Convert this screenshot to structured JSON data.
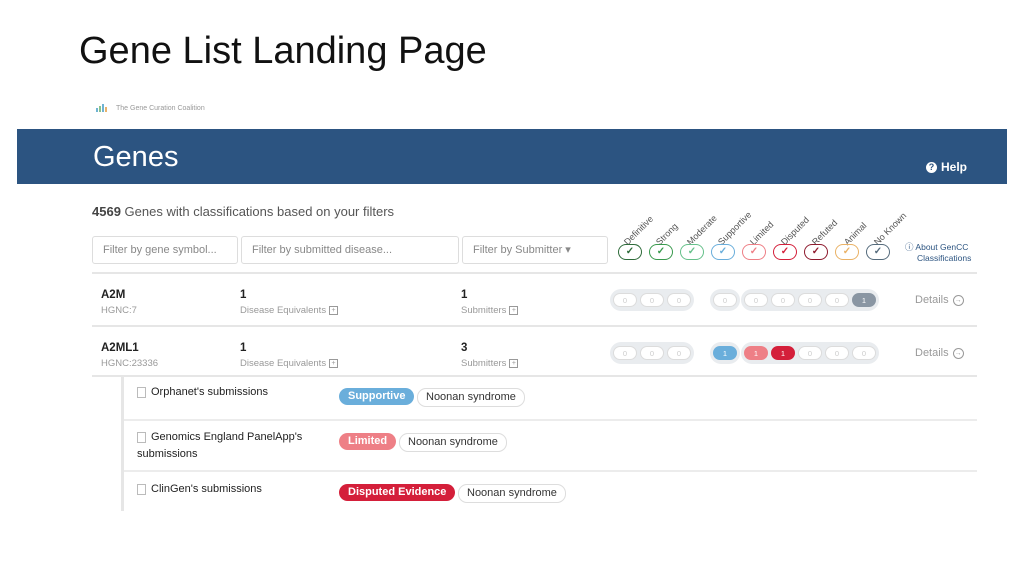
{
  "slide_title": "Gene List Landing Page",
  "logo_text": "The Gene Curation Coalition",
  "header": {
    "title": "Genes",
    "help_label": "Help",
    "help_icon": "question-circle-icon"
  },
  "summary": {
    "count": "4569",
    "text": "Genes with classifications based on your filters"
  },
  "filters": {
    "gene_placeholder": "Filter by gene symbol...",
    "disease_placeholder": "Filter by submitted disease...",
    "submitter_placeholder": "Filter by Submitter ▾"
  },
  "legend": [
    {
      "label": "Definitive",
      "color": "#2e6b3a"
    },
    {
      "label": "Strong",
      "color": "#3a9a4e"
    },
    {
      "label": "Moderate",
      "color": "#66c08a"
    },
    {
      "label": "Supportive",
      "color": "#6aaedb"
    },
    {
      "label": "Limited",
      "color": "#ee7f86"
    },
    {
      "label": "Disputed",
      "color": "#d41f3a"
    },
    {
      "label": "Refuted",
      "color": "#8e1b2e"
    },
    {
      "label": "Animal",
      "color": "#eab266"
    },
    {
      "label": "No Known",
      "color": "#556b7c"
    }
  ],
  "about": {
    "line1": "About GenCC",
    "line2": "Classifications"
  },
  "genes": [
    {
      "symbol": "A2M",
      "hgnc": "HGNC:7",
      "diseases_count": "1",
      "diseases_label": "Disease Equivalents",
      "submitters_count": "1",
      "submitters_label": "Submitters",
      "pills": [
        "0",
        "0",
        "0",
        "0",
        "0",
        "0",
        "0",
        "0",
        "1"
      ],
      "details": "Details"
    },
    {
      "symbol": "A2ML1",
      "hgnc": "HGNC:23336",
      "diseases_count": "1",
      "diseases_label": "Disease Equivalents",
      "submitters_count": "3",
      "submitters_label": "Submitters",
      "pills": [
        "0",
        "0",
        "0",
        "1",
        "1",
        "1",
        "0",
        "0",
        "0"
      ],
      "details": "Details"
    }
  ],
  "submissions": [
    {
      "submitter": "Orphanet's submissions",
      "classification": "Supportive",
      "color": "#6aaedb",
      "disease": "Noonan syndrome"
    },
    {
      "submitter_line1": "Genomics England PanelApp's",
      "submitter_line2": "submissions",
      "classification": "Limited",
      "color": "#ee7f86",
      "disease": "Noonan syndrome"
    },
    {
      "submitter": "ClinGen's submissions",
      "classification": "Disputed Evidence",
      "color": "#d41f3a",
      "disease": "Noonan syndrome"
    }
  ]
}
